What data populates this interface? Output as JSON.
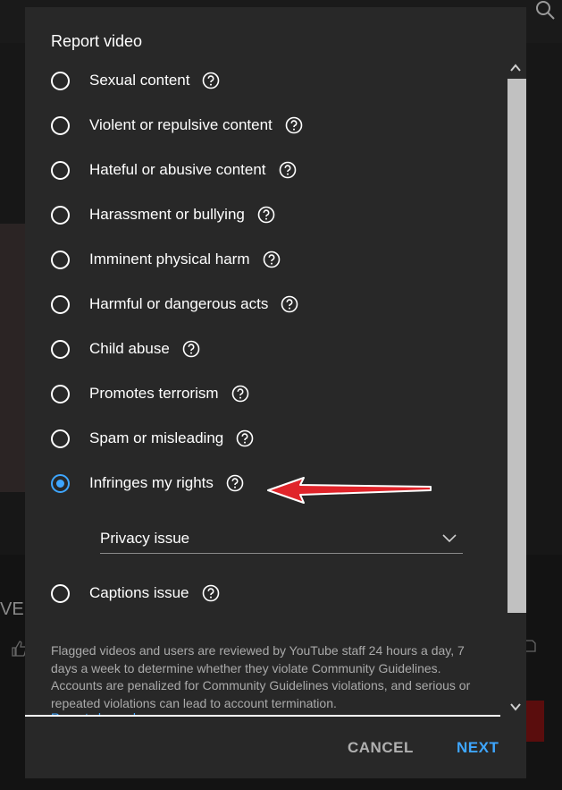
{
  "dialog": {
    "title": "Report video",
    "options": [
      {
        "label": "Sexual content",
        "checked": false
      },
      {
        "label": "Violent or repulsive content",
        "checked": false
      },
      {
        "label": "Hateful or abusive content",
        "checked": false
      },
      {
        "label": "Harassment or bullying",
        "checked": false
      },
      {
        "label": "Imminent physical harm",
        "checked": false
      },
      {
        "label": "Harmful or dangerous acts",
        "checked": false
      },
      {
        "label": "Child abuse",
        "checked": false
      },
      {
        "label": "Promotes terrorism",
        "checked": false
      },
      {
        "label": "Spam or misleading",
        "checked": false
      },
      {
        "label": "Infringes my rights",
        "checked": true
      },
      {
        "label": "Captions issue",
        "checked": false
      }
    ],
    "subreason": {
      "selected": "Privacy issue"
    },
    "description": "Flagged videos and users are reviewed by YouTube staff 24 hours a day, 7 days a week to determine whether they violate Community Guidelines. Accounts are penalized for Community Guidelines violations, and serious or repeated violations can lead to account termination.",
    "learn_more": "Report channel",
    "buttons": {
      "cancel": "CANCEL",
      "next": "NEXT"
    }
  },
  "background": {
    "partial_text": "VE"
  },
  "colors": {
    "accent": "#3ea6ff",
    "annotation_arrow": "#e0242a",
    "dialog_bg": "#282828"
  },
  "icons": [
    "help-icon",
    "chevron-down-icon",
    "scroll-up-icon",
    "scroll-down-icon",
    "search-icon",
    "like-icon",
    "save-icon"
  ]
}
